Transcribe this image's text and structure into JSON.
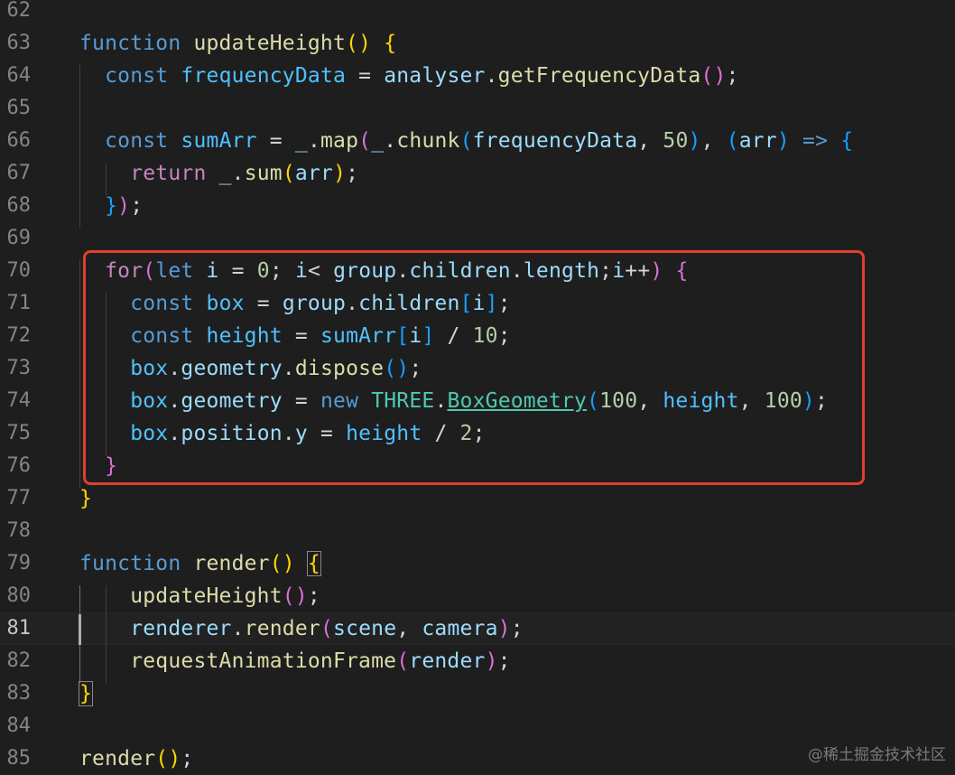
{
  "editor": {
    "current_line": 81,
    "lines": [
      {
        "n": "62",
        "tokens": []
      },
      {
        "n": "63",
        "tokens": [
          [
            "kw",
            "function"
          ],
          [
            "txt",
            " "
          ],
          [
            "fn",
            "updateHeight"
          ],
          [
            "b1",
            "()"
          ],
          [
            "txt",
            " "
          ],
          [
            "b1",
            "{"
          ]
        ]
      },
      {
        "n": "64",
        "tokens": [
          [
            "txt",
            "  "
          ],
          [
            "kw",
            "const"
          ],
          [
            "txt",
            " "
          ],
          [
            "cst",
            "frequencyData"
          ],
          [
            "txt",
            " = "
          ],
          [
            "var",
            "analyser"
          ],
          [
            "txt",
            "."
          ],
          [
            "fn",
            "getFrequencyData"
          ],
          [
            "b2",
            "()"
          ],
          [
            "txt",
            ";"
          ]
        ]
      },
      {
        "n": "65",
        "tokens": []
      },
      {
        "n": "66",
        "tokens": [
          [
            "txt",
            "  "
          ],
          [
            "kw",
            "const"
          ],
          [
            "txt",
            " "
          ],
          [
            "cst",
            "sumArr"
          ],
          [
            "txt",
            " = "
          ],
          [
            "var",
            "_"
          ],
          [
            "txt",
            "."
          ],
          [
            "fn",
            "map"
          ],
          [
            "b2",
            "("
          ],
          [
            "var",
            "_"
          ],
          [
            "txt",
            "."
          ],
          [
            "fn",
            "chunk"
          ],
          [
            "b3",
            "("
          ],
          [
            "var",
            "frequencyData"
          ],
          [
            "txt",
            ", "
          ],
          [
            "num",
            "50"
          ],
          [
            "b3",
            ")"
          ],
          [
            "txt",
            ", "
          ],
          [
            "b3",
            "("
          ],
          [
            "var",
            "arr"
          ],
          [
            "b3",
            ")"
          ],
          [
            "txt",
            " "
          ],
          [
            "kw",
            "=>"
          ],
          [
            "txt",
            " "
          ],
          [
            "b3",
            "{"
          ]
        ]
      },
      {
        "n": "67",
        "tokens": [
          [
            "txt",
            "    "
          ],
          [
            "ctl",
            "return"
          ],
          [
            "txt",
            " "
          ],
          [
            "var",
            "_"
          ],
          [
            "txt",
            "."
          ],
          [
            "fn",
            "sum"
          ],
          [
            "b1",
            "("
          ],
          [
            "var",
            "arr"
          ],
          [
            "b1",
            ")"
          ],
          [
            "txt",
            ";"
          ]
        ]
      },
      {
        "n": "68",
        "tokens": [
          [
            "txt",
            "  "
          ],
          [
            "b3",
            "}"
          ],
          [
            "b2",
            ")"
          ],
          [
            "txt",
            ";"
          ]
        ]
      },
      {
        "n": "69",
        "tokens": []
      },
      {
        "n": "70",
        "tokens": [
          [
            "txt",
            "  "
          ],
          [
            "ctl",
            "for"
          ],
          [
            "b2",
            "("
          ],
          [
            "kw",
            "let"
          ],
          [
            "txt",
            " "
          ],
          [
            "var",
            "i"
          ],
          [
            "txt",
            " = "
          ],
          [
            "num",
            "0"
          ],
          [
            "txt",
            "; "
          ],
          [
            "var",
            "i"
          ],
          [
            "txt",
            "< "
          ],
          [
            "var",
            "group"
          ],
          [
            "txt",
            "."
          ],
          [
            "var",
            "children"
          ],
          [
            "txt",
            "."
          ],
          [
            "var",
            "length"
          ],
          [
            "txt",
            ";"
          ],
          [
            "var",
            "i"
          ],
          [
            "txt",
            "++"
          ],
          [
            "b2",
            ")"
          ],
          [
            "txt",
            " "
          ],
          [
            "b2",
            "{"
          ]
        ]
      },
      {
        "n": "71",
        "tokens": [
          [
            "txt",
            "    "
          ],
          [
            "kw",
            "const"
          ],
          [
            "txt",
            " "
          ],
          [
            "cst",
            "box"
          ],
          [
            "txt",
            " = "
          ],
          [
            "var",
            "group"
          ],
          [
            "txt",
            "."
          ],
          [
            "var",
            "children"
          ],
          [
            "b3",
            "["
          ],
          [
            "var",
            "i"
          ],
          [
            "b3",
            "]"
          ],
          [
            "txt",
            ";"
          ]
        ]
      },
      {
        "n": "72",
        "tokens": [
          [
            "txt",
            "    "
          ],
          [
            "kw",
            "const"
          ],
          [
            "txt",
            " "
          ],
          [
            "cst",
            "height"
          ],
          [
            "txt",
            " = "
          ],
          [
            "cst",
            "sumArr"
          ],
          [
            "b3",
            "["
          ],
          [
            "var",
            "i"
          ],
          [
            "b3",
            "]"
          ],
          [
            "txt",
            " / "
          ],
          [
            "num",
            "10"
          ],
          [
            "txt",
            ";"
          ]
        ]
      },
      {
        "n": "73",
        "tokens": [
          [
            "txt",
            "    "
          ],
          [
            "cst",
            "box"
          ],
          [
            "txt",
            "."
          ],
          [
            "var",
            "geometry"
          ],
          [
            "txt",
            "."
          ],
          [
            "fn",
            "dispose"
          ],
          [
            "b3",
            "()"
          ],
          [
            "txt",
            ";"
          ]
        ]
      },
      {
        "n": "74",
        "tokens": [
          [
            "txt",
            "    "
          ],
          [
            "cst",
            "box"
          ],
          [
            "txt",
            "."
          ],
          [
            "var",
            "geometry"
          ],
          [
            "txt",
            " = "
          ],
          [
            "kw",
            "new"
          ],
          [
            "txt",
            " "
          ],
          [
            "cls",
            "THREE"
          ],
          [
            "txt",
            "."
          ],
          [
            "ty",
            "BoxGeometry"
          ],
          [
            "b3",
            "("
          ],
          [
            "num",
            "100"
          ],
          [
            "txt",
            ", "
          ],
          [
            "cst",
            "height"
          ],
          [
            "txt",
            ", "
          ],
          [
            "num",
            "100"
          ],
          [
            "b3",
            ")"
          ],
          [
            "txt",
            ";"
          ]
        ]
      },
      {
        "n": "75",
        "tokens": [
          [
            "txt",
            "    "
          ],
          [
            "cst",
            "box"
          ],
          [
            "txt",
            "."
          ],
          [
            "var",
            "position"
          ],
          [
            "txt",
            "."
          ],
          [
            "var",
            "y"
          ],
          [
            "txt",
            " = "
          ],
          [
            "cst",
            "height"
          ],
          [
            "txt",
            " / "
          ],
          [
            "num",
            "2"
          ],
          [
            "txt",
            ";"
          ]
        ]
      },
      {
        "n": "76",
        "tokens": [
          [
            "txt",
            "  "
          ],
          [
            "b2",
            "}"
          ]
        ]
      },
      {
        "n": "77",
        "tokens": [
          [
            "b1",
            "}"
          ]
        ]
      },
      {
        "n": "78",
        "tokens": []
      },
      {
        "n": "79",
        "tokens": [
          [
            "kw",
            "function"
          ],
          [
            "txt",
            " "
          ],
          [
            "fn",
            "render"
          ],
          [
            "b1",
            "()"
          ],
          [
            "txt",
            " "
          ],
          [
            "b1",
            "{"
          ]
        ]
      },
      {
        "n": "80",
        "tokens": [
          [
            "txt",
            "    "
          ],
          [
            "fn",
            "updateHeight"
          ],
          [
            "b2",
            "()"
          ],
          [
            "txt",
            ";"
          ]
        ]
      },
      {
        "n": "81",
        "tokens": [
          [
            "txt",
            "    "
          ],
          [
            "var",
            "renderer"
          ],
          [
            "txt",
            "."
          ],
          [
            "fn",
            "render"
          ],
          [
            "b2",
            "("
          ],
          [
            "var",
            "scene"
          ],
          [
            "txt",
            ", "
          ],
          [
            "var",
            "camera"
          ],
          [
            "b2",
            ")"
          ],
          [
            "txt",
            ";"
          ]
        ]
      },
      {
        "n": "82",
        "tokens": [
          [
            "txt",
            "    "
          ],
          [
            "fn",
            "requestAnimationFrame"
          ],
          [
            "b2",
            "("
          ],
          [
            "var",
            "render"
          ],
          [
            "b2",
            ")"
          ],
          [
            "txt",
            ";"
          ]
        ]
      },
      {
        "n": "83",
        "tokens": [
          [
            "b1",
            "}"
          ]
        ]
      },
      {
        "n": "84",
        "tokens": []
      },
      {
        "n": "85",
        "tokens": [
          [
            "fn",
            "render"
          ],
          [
            "b1",
            "()"
          ],
          [
            "txt",
            ";"
          ]
        ]
      }
    ]
  },
  "watermark": "@稀土掘金技术社区",
  "colors": {
    "background": "#1e1e1e",
    "highlight_box": "#e0402c"
  }
}
